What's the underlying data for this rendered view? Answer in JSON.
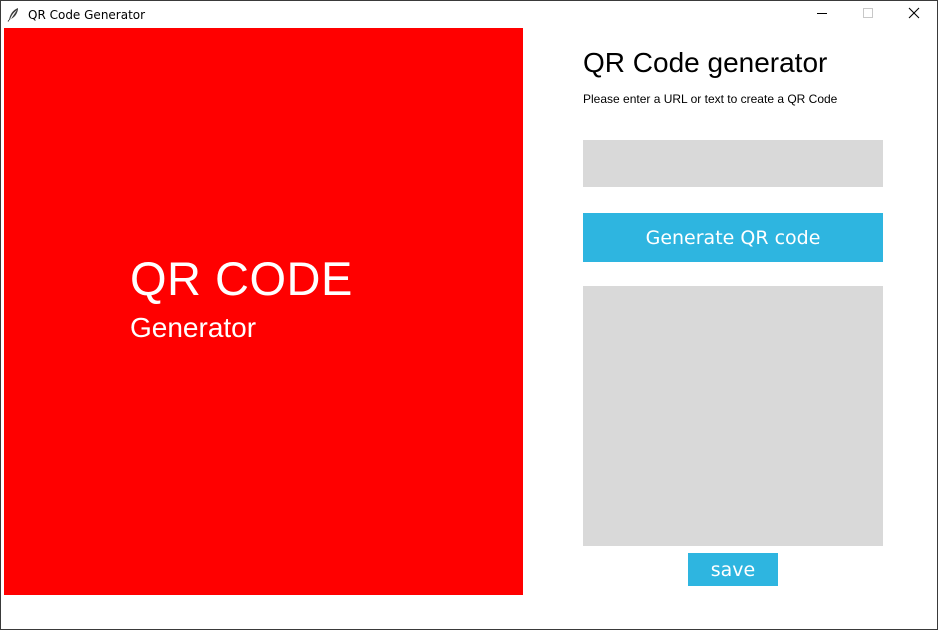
{
  "window": {
    "title": "QR Code Generator",
    "controls": [
      "minimize-icon",
      "maximize-icon",
      "close-icon"
    ]
  },
  "banner": {
    "title": "QR CODE",
    "subtitle": "Generator",
    "background_color": "#ff0000"
  },
  "form": {
    "heading": "QR Code generator",
    "instructions": "Please enter a URL or text to create a QR Code",
    "input_value": "",
    "generate_label": "Generate QR code",
    "save_label": "save",
    "accent_color": "#2eb5e0",
    "field_color": "#d9d9d9"
  }
}
